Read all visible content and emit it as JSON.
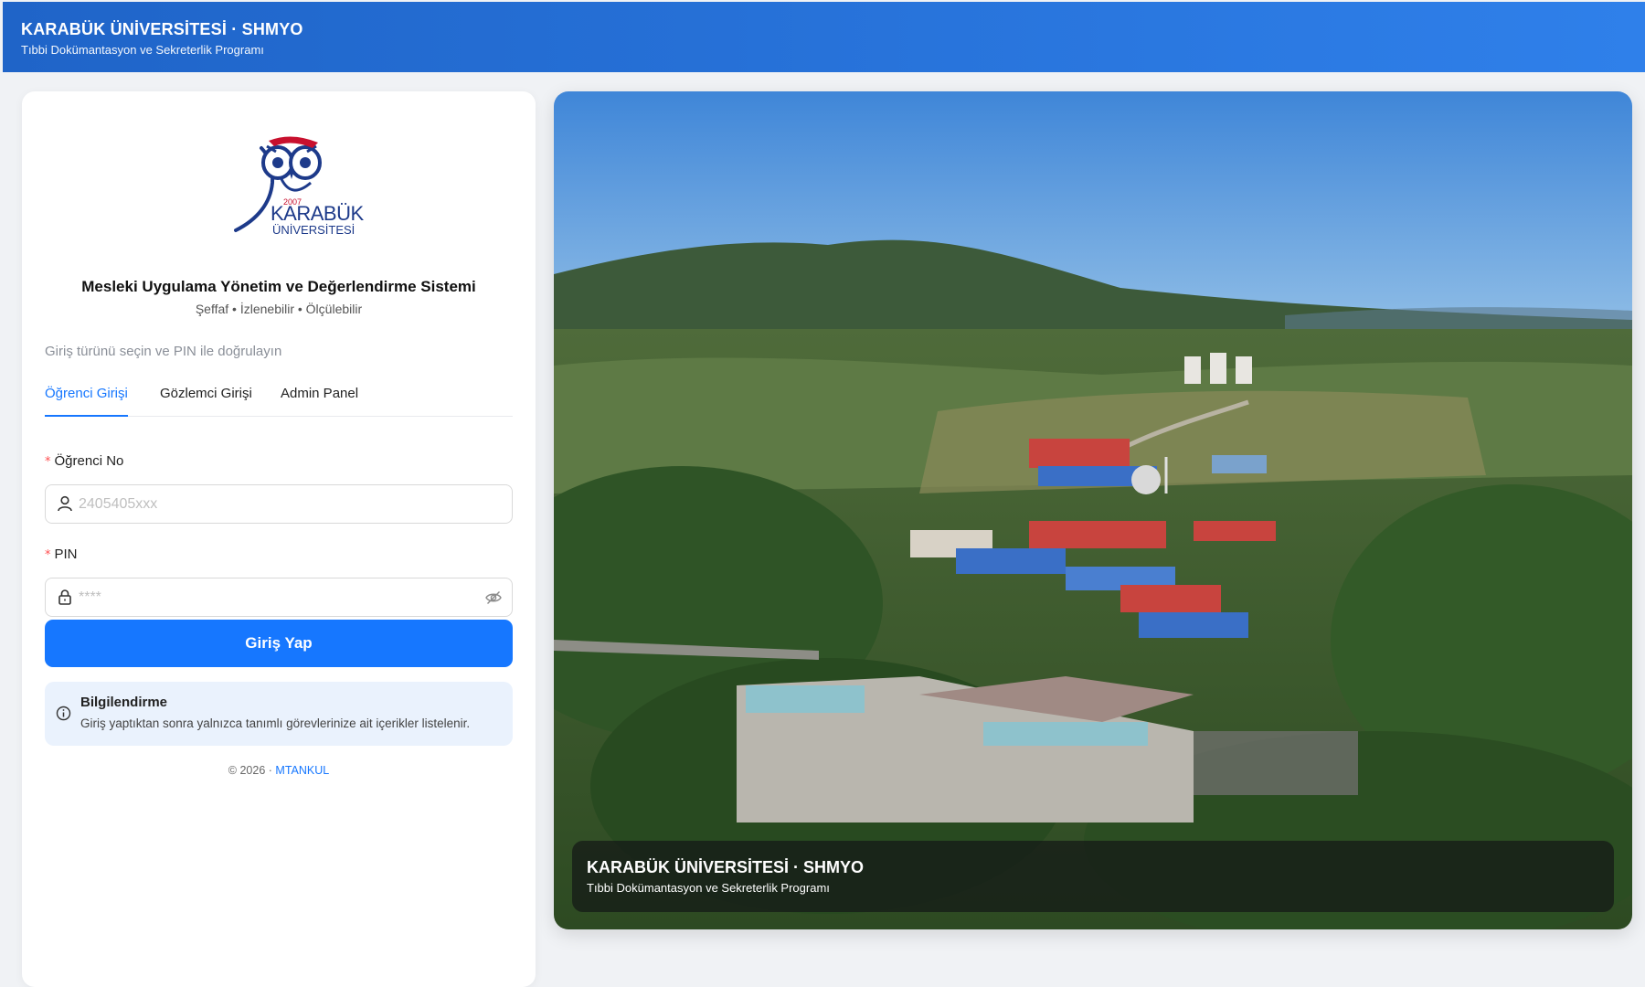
{
  "header": {
    "title": "KARABÜK ÜNİVERSİTESİ · SHMYO",
    "subtitle": "Tıbbi Dokümantasyon ve Sekreterlik Programı"
  },
  "logo": {
    "year": "2007",
    "name_line1": "KARABÜK",
    "name_line2": "ÜNİVERSİTESİ",
    "icon": "owl-logo"
  },
  "system": {
    "title": "Mesleki Uygulama Yönetim ve Değerlendirme Sistemi",
    "tagline": "Şeffaf • İzlenebilir • Ölçülebilir"
  },
  "login": {
    "hint": "Giriş türünü seçin ve PIN ile doğrulayın",
    "tabs": [
      {
        "label": "Öğrenci Girişi",
        "active": true
      },
      {
        "label": "Gözlemci Girişi",
        "active": false
      },
      {
        "label": "Admin Panel",
        "active": false
      }
    ],
    "student_no": {
      "required_mark": "*",
      "label": "Öğrenci No",
      "placeholder": "2405405xxx",
      "value": "",
      "icon": "user-icon"
    },
    "pin": {
      "required_mark": "*",
      "label": "PIN",
      "placeholder": "****",
      "value": "",
      "icon": "lock-icon",
      "toggle_icon": "eye-invisible-icon"
    },
    "submit_label": "Giriş Yap"
  },
  "notice": {
    "icon": "info-icon",
    "title": "Bilgilendirme",
    "text": "Giriş yaptıktan sonra yalnızca tanımlı görevlerinize ait içerikler listelenir."
  },
  "footer": {
    "copyright": "© 2026 ·",
    "author": "MTANKUL"
  },
  "hero": {
    "caption_title": "KARABÜK ÜNİVERSİTESİ · SHMYO",
    "caption_subtitle": "Tıbbi Dokümantasyon ve Sekreterlik Programı"
  },
  "colors": {
    "header_gradient_start": "#1f64c8",
    "header_gradient_end": "#2f80ea",
    "primary": "#1677ff",
    "required": "#ff4d4f",
    "info_bg": "#eaf2fd"
  }
}
